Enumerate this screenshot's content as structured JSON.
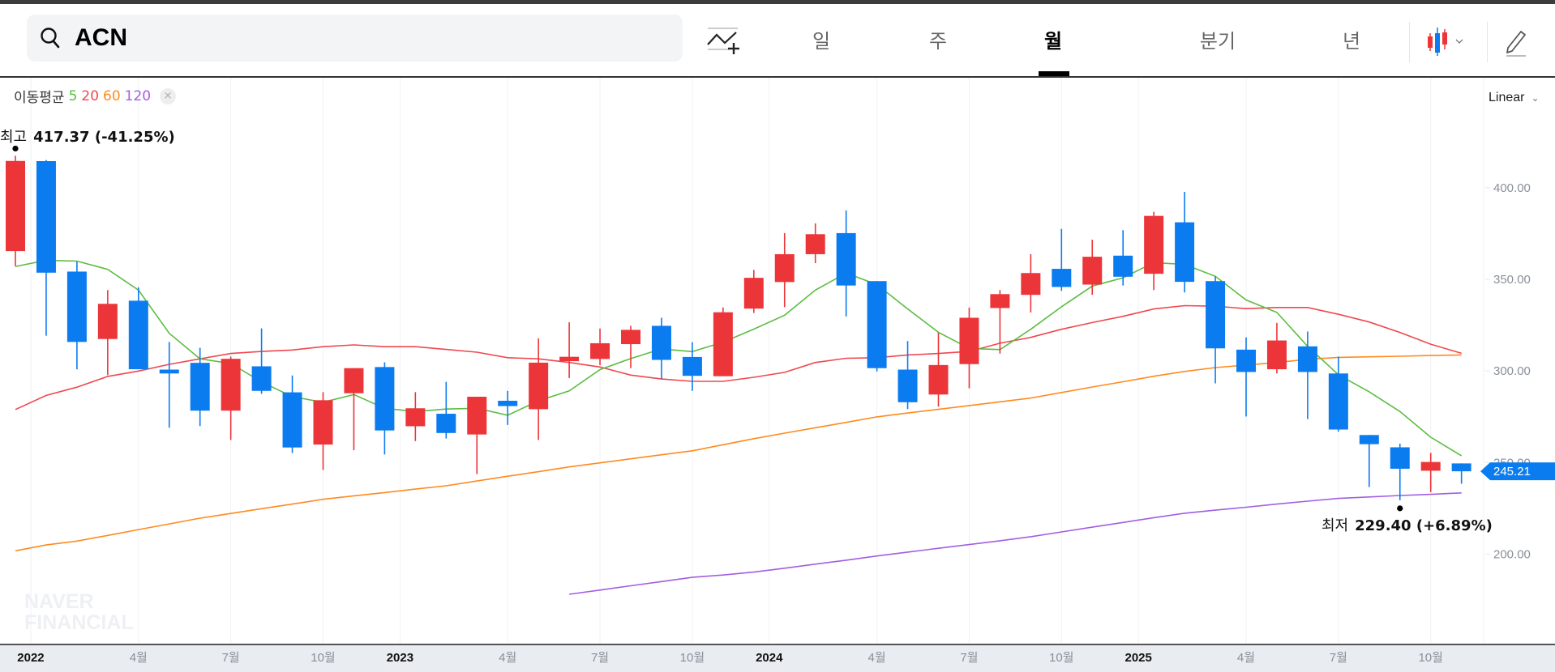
{
  "search": {
    "value": "ACN"
  },
  "tabs": [
    {
      "label": "일",
      "active": false
    },
    {
      "label": "주",
      "active": false
    },
    {
      "label": "월",
      "active": true
    },
    {
      "label": "분기",
      "active": false
    },
    {
      "label": "년",
      "active": false
    }
  ],
  "legend": {
    "title": "이동평균",
    "ma5": "5",
    "ma20": "20",
    "ma60": "60",
    "ma120": "120",
    "close": "×"
  },
  "scale": {
    "label": "Linear"
  },
  "max_marker": {
    "label": "최고",
    "value": "417.37 (-41.25%)"
  },
  "min_marker": {
    "label": "최저",
    "value": "229.40 (+6.89%)"
  },
  "watermark": "NAVER FINANCIAL",
  "colors": {
    "up": "#ec3539",
    "down": "#0b7cf0",
    "ma5": "#5cbd3f",
    "ma20": "#f0474f",
    "ma60": "#ff8a1e",
    "ma120": "#a35ee0"
  },
  "chart_data": {
    "type": "candlestick",
    "symbol": "ACN",
    "period": "monthly",
    "y_ticks": [
      "400.00",
      "350.00",
      "300.00",
      "250.00",
      "200.00"
    ],
    "y_tick_values": [
      400,
      350,
      300,
      250,
      200
    ],
    "last_price": "245.21",
    "last_price_value": 245.21,
    "x_ticks": [
      {
        "label": "2022",
        "pos": 0.5,
        "year": true
      },
      {
        "label": "4월",
        "pos": 4,
        "year": false
      },
      {
        "label": "7월",
        "pos": 7,
        "year": false
      },
      {
        "label": "10월",
        "pos": 10,
        "year": false
      },
      {
        "label": "2023",
        "pos": 12.5,
        "year": true
      },
      {
        "label": "4월",
        "pos": 16,
        "year": false
      },
      {
        "label": "7월",
        "pos": 19,
        "year": false
      },
      {
        "label": "10월",
        "pos": 22,
        "year": false
      },
      {
        "label": "2024",
        "pos": 24.5,
        "year": true
      },
      {
        "label": "4월",
        "pos": 28,
        "year": false
      },
      {
        "label": "7월",
        "pos": 31,
        "year": false
      },
      {
        "label": "10월",
        "pos": 34,
        "year": false
      },
      {
        "label": "2025",
        "pos": 36.5,
        "year": true
      },
      {
        "label": "4월",
        "pos": 40,
        "year": false
      },
      {
        "label": "7월",
        "pos": 43,
        "year": false
      },
      {
        "label": "10월",
        "pos": 46,
        "year": false
      }
    ],
    "candles_ohlc": [
      [
        365.4,
        417.4,
        357.2,
        414.6
      ],
      [
        414.5,
        415.1,
        319.2,
        353.6
      ],
      [
        354.2,
        359.6,
        300.9,
        315.8
      ],
      [
        317.4,
        344.1,
        297.7,
        336.6
      ],
      [
        338.3,
        345.6,
        300.9,
        300.9
      ],
      [
        300.7,
        315.8,
        269.0,
        298.6
      ],
      [
        304.4,
        312.6,
        269.9,
        278.3
      ],
      [
        278.3,
        307.8,
        262.3,
        306.6
      ],
      [
        302.5,
        323.2,
        287.5,
        289.1
      ],
      [
        288.3,
        297.5,
        255.2,
        258.2
      ],
      [
        259.8,
        288.4,
        245.9,
        284.0
      ],
      [
        287.8,
        301.5,
        256.7,
        301.5
      ],
      [
        302.1,
        304.7,
        254.4,
        267.5
      ],
      [
        269.8,
        288.4,
        261.7,
        279.6
      ],
      [
        276.6,
        294.0,
        263.1,
        266.1
      ],
      [
        265.3,
        285.9,
        243.7,
        285.9
      ],
      [
        283.7,
        289.1,
        270.5,
        280.8
      ],
      [
        279.1,
        317.8,
        262.3,
        304.5
      ],
      [
        305.3,
        326.5,
        296.1,
        307.7
      ],
      [
        306.5,
        323.1,
        303.1,
        315.1
      ],
      [
        314.6,
        324.6,
        301.5,
        322.4
      ],
      [
        324.6,
        329.0,
        295.4,
        306.0
      ],
      [
        307.6,
        315.7,
        289.1,
        297.3
      ],
      [
        297.1,
        334.6,
        297.1,
        332.0
      ],
      [
        334.0,
        355.1,
        331.6,
        350.8
      ],
      [
        348.5,
        375.2,
        334.8,
        363.7
      ],
      [
        363.7,
        380.5,
        358.8,
        374.6
      ],
      [
        375.2,
        387.6,
        329.7,
        346.6
      ],
      [
        349.0,
        349.0,
        299.7,
        301.5
      ],
      [
        300.7,
        316.3,
        279.2,
        282.9
      ],
      [
        287.1,
        320.8,
        280.5,
        303.2
      ],
      [
        303.7,
        334.6,
        290.5,
        329.0
      ],
      [
        334.3,
        344.1,
        309.4,
        341.9
      ],
      [
        341.5,
        363.7,
        331.9,
        353.4
      ],
      [
        355.7,
        377.5,
        343.7,
        345.8
      ],
      [
        347.1,
        371.6,
        341.5,
        362.3
      ],
      [
        362.9,
        376.8,
        346.6,
        351.4
      ],
      [
        353.0,
        386.8,
        344.1,
        384.6
      ],
      [
        381.1,
        397.7,
        342.8,
        348.6
      ],
      [
        349.0,
        351.6,
        293.2,
        312.3
      ],
      [
        311.6,
        318.3,
        275.1,
        299.4
      ],
      [
        300.9,
        326.2,
        298.6,
        316.6
      ],
      [
        313.4,
        321.5,
        273.7,
        299.4
      ],
      [
        298.6,
        307.8,
        266.8,
        268.0
      ],
      [
        265.0,
        265.0,
        236.6,
        260.0
      ],
      [
        258.3,
        260.3,
        229.4,
        246.6
      ],
      [
        245.5,
        255.3,
        233.8,
        250.3
      ],
      [
        249.5,
        249.5,
        238.4,
        245.21
      ]
    ],
    "ma": {
      "5": [
        357,
        360.3,
        359.9,
        355.4,
        344.1,
        320.5,
        306.6,
        304,
        294,
        285.9,
        282.9,
        287.1,
        279.6,
        277.8,
        279.2,
        279.6,
        275.8,
        283.7,
        289.1,
        300.7,
        306.7,
        312,
        310.5,
        315.7,
        322.8,
        330.4,
        344.1,
        353.4,
        347.1,
        333.8,
        321.1,
        312.3,
        311.6,
        322.7,
        335,
        346.3,
        350.8,
        359.1,
        358.1,
        351.6,
        338.7,
        331.9,
        313.4,
        297.9,
        288.6,
        277.8,
        263.8,
        253.7
      ],
      "20": [
        278.9,
        286.6,
        291.1,
        297,
        299.9,
        303.6,
        306.6,
        309.5,
        310.6,
        311.4,
        313.2,
        314.2,
        313.2,
        313.2,
        311.7,
        310.2,
        307.2,
        306.6,
        304.6,
        302.1,
        297.7,
        295.6,
        294.3,
        294.3,
        296.5,
        299.2,
        304.6,
        306.9,
        307.2,
        308.7,
        309.5,
        310.6,
        315.1,
        318.3,
        322.7,
        326.4,
        329.8,
        333.8,
        335.6,
        335.3,
        334,
        334.6,
        334.6,
        330.9,
        326.7,
        321,
        314.6,
        309.6
      ],
      "60": [
        201.8,
        205,
        207.1,
        210.2,
        213.4,
        216.5,
        219.6,
        222.2,
        224.8,
        227.3,
        229.9,
        231.8,
        233.6,
        235.5,
        237.3,
        239.9,
        242.5,
        245,
        247.6,
        249.8,
        252,
        254.2,
        256.4,
        259.7,
        263,
        266,
        269,
        271.9,
        274.9,
        277,
        279,
        281.1,
        283.1,
        285.2,
        288.2,
        291.2,
        294.1,
        297.1,
        299.7,
        301.8,
        303.2,
        304.6,
        306.3,
        307.4,
        307.7,
        308,
        308.4,
        308.7
      ],
      "120": [
        null,
        null,
        null,
        null,
        null,
        null,
        null,
        null,
        null,
        null,
        null,
        null,
        null,
        null,
        null,
        null,
        null,
        null,
        178.1,
        180.4,
        182.7,
        185,
        187.3,
        188.6,
        190.2,
        192.3,
        194.5,
        196.7,
        199,
        201.1,
        203.2,
        205.2,
        207.3,
        209.5,
        212.1,
        214.7,
        217.3,
        219.9,
        222.3,
        224,
        225.6,
        227.3,
        228.9,
        230.4,
        231.2,
        232,
        232.6,
        233.4
      ]
    },
    "max_index": 0,
    "min_index": 45
  }
}
